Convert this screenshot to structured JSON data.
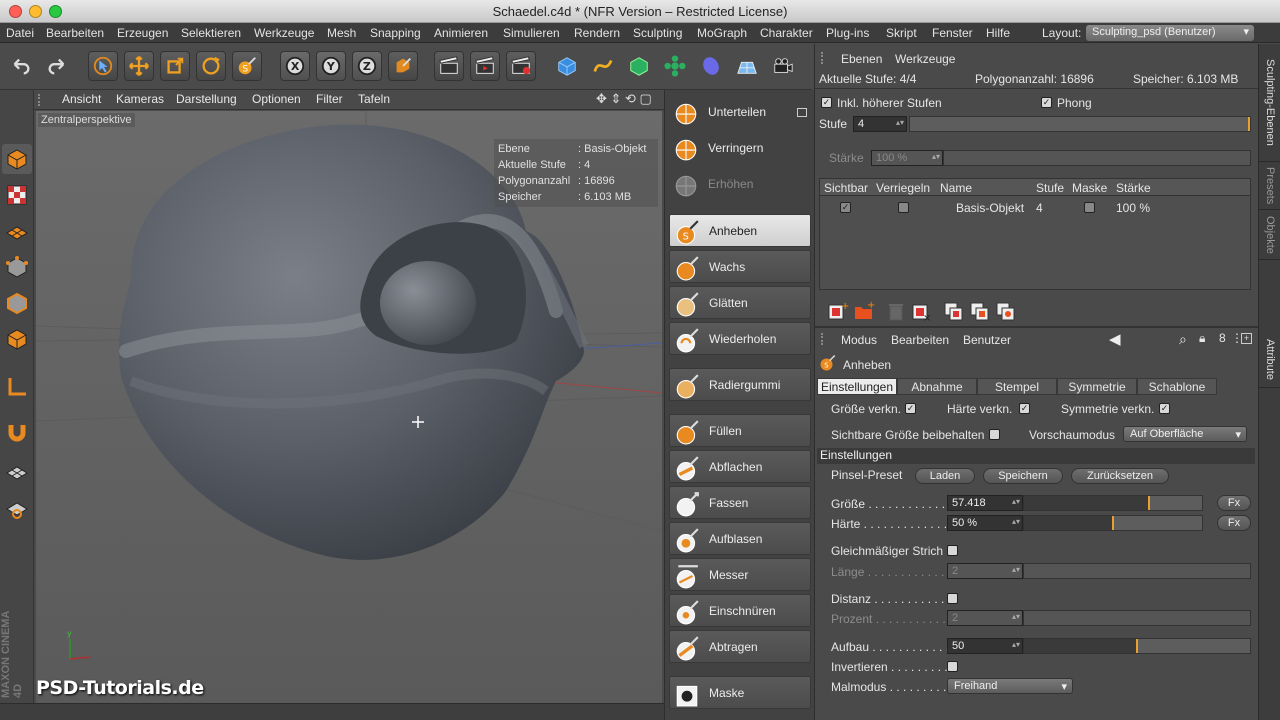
{
  "window": {
    "title": "Schaedel.c4d * (NFR Version – Restricted License)"
  },
  "menu": {
    "items": [
      "Datei",
      "Bearbeiten",
      "Erzeugen",
      "Selektieren",
      "Werkzeuge",
      "Mesh",
      "Snapping",
      "Animieren",
      "Simulieren",
      "Rendern",
      "Sculpting",
      "MoGraph",
      "Charakter",
      "Plug-ins",
      "Skript",
      "Fenster",
      "Hilfe"
    ],
    "layout_label": "Layout:",
    "layout_value": "Sculpting_psd (Benutzer)"
  },
  "toolbar": {
    "axis_x": "X",
    "axis_y": "Y",
    "axis_z": "Z"
  },
  "viewport": {
    "menu": [
      "Ansicht",
      "Kameras",
      "Darstellung",
      "Optionen",
      "Filter",
      "Tafeln"
    ],
    "label": "Zentralperspektive",
    "hud": {
      "ebene_k": "Ebene",
      "ebene_v": "Basis-Objekt",
      "stufe_k": "Aktuelle Stufe",
      "stufe_v": "4",
      "poly_k": "Polygonanzahl",
      "poly_v": "16896",
      "spei_k": "Speicher",
      "spei_v": "6.103 MB"
    },
    "watermark": "PSD-Tutorials.de",
    "maxon": "MAXON CINEMA 4D"
  },
  "brushes": [
    {
      "label": "Unterteilen"
    },
    {
      "label": "Verringern"
    },
    {
      "label": "Erhöhen"
    },
    {
      "label": "Anheben"
    },
    {
      "label": "Wachs"
    },
    {
      "label": "Glätten"
    },
    {
      "label": "Wiederholen"
    },
    {
      "label": "Radiergummi"
    },
    {
      "label": "Füllen"
    },
    {
      "label": "Abflachen"
    },
    {
      "label": "Fassen"
    },
    {
      "label": "Aufblasen"
    },
    {
      "label": "Messer"
    },
    {
      "label": "Einschnüren"
    },
    {
      "label": "Abtragen"
    },
    {
      "label": "Maske"
    }
  ],
  "layers": {
    "menu1": "Ebenen",
    "menu2": "Werkzeuge",
    "stufe_info": "Aktuelle Stufe: 4/4",
    "poly_info": "Polygonanzahl: 16896",
    "spei_info": "Speicher: 6.103 MB",
    "inkl": "Inkl. höherer Stufen",
    "phong": "Phong",
    "stufe_label": "Stufe",
    "stufe_value": "4",
    "staerke_label": "Stärke",
    "staerke_value": "100 %",
    "columns": [
      "Sichtbar",
      "Verriegeln",
      "Name",
      "Stufe",
      "Maske",
      "Stärke"
    ],
    "row": {
      "name": "Basis-Objekt",
      "stufe": "4",
      "staerke": "100 %"
    }
  },
  "attributes": {
    "menu": [
      "Modus",
      "Bearbeiten",
      "Benutzer"
    ],
    "tool_name": "Anheben",
    "tabs": [
      "Einstellungen",
      "Abnahme",
      "Stempel",
      "Symmetrie",
      "Schablone"
    ],
    "groesse_verkn": "Größe verkn.",
    "haerte_verkn": "Härte verkn.",
    "symm_verkn": "Symmetrie verkn.",
    "sichtbar": "Sichtbare Größe beibehalten",
    "vorschau_label": "Vorschaumodus",
    "vorschau_value": "Auf Oberfläche",
    "section": "Einstellungen",
    "preset_label": "Pinsel-Preset",
    "btn_laden": "Laden",
    "btn_speichern": "Speichern",
    "btn_zurueck": "Zurücksetzen",
    "groesse_label": "Größe . . . . . . . . . . . . . .",
    "groesse_value": "57.418",
    "groesse_fraction": 0.7,
    "haerte_label": "Härte . . . . . . . . . . . . . .",
    "haerte_value": "50 %",
    "haerte_fraction": 0.5,
    "fx": "Fx",
    "gleich": "Gleichmäßiger Strich",
    "laenge_label": "Länge . . . . . . . . . . . . .",
    "laenge_value": "2",
    "distanz_label": "Distanz . . . . . . . . . . .",
    "prozent_label": "Prozent . . . . . . . . . . . .",
    "prozent_value": "2",
    "aufbau_label": "Aufbau . . . . . . . . . . . .",
    "aufbau_value": "50",
    "aufbau_fraction": 0.5,
    "invert_label": "Invertieren . . . . . . . . .",
    "malmodus_label": "Malmodus . . . . . . . . .",
    "malmodus_value": "Freihand"
  },
  "sidetabs": [
    "Sculpting-Ebenen",
    "Presets",
    "Objekte",
    "Attribute"
  ],
  "colors": {
    "accent": "#e8a030",
    "background": "#4a4a4a",
    "active_tab": "#ececec"
  }
}
